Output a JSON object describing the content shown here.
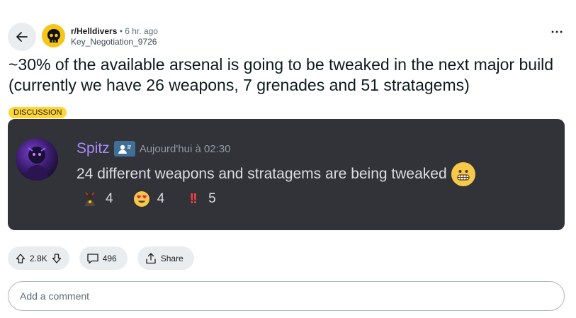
{
  "post": {
    "subreddit": "r/Helldivers",
    "separator": "•",
    "time": "6 hr. ago",
    "author": "Key_Negotiation_9726",
    "title": "~30% of the available arsenal is going to be tweaked in the next major build (currently we have 26 weapons, 7 grenades and 51 stratagems)",
    "flair": "DISCUSSION",
    "more_icon": "⋯"
  },
  "embed": {
    "username": "Spitz",
    "timestamp": "Aujourd'hui à 02:30",
    "message": "24 different weapons and stratagems are being tweaked",
    "reactions": [
      {
        "icon": "character-emoji",
        "count": "4"
      },
      {
        "icon": "heart-eyes-emoji",
        "count": "4"
      },
      {
        "icon": "double-exclamation-emoji",
        "glyph": "!!",
        "count": "5"
      }
    ]
  },
  "actions": {
    "votes": "2.8K",
    "comments": "496",
    "share": "Share"
  },
  "comment": {
    "placeholder": "Add a comment"
  },
  "colors": {
    "flair": "#ffd635",
    "embed_bg": "#313338",
    "username": "#a78bfa",
    "pill_bg": "#eaedef"
  }
}
